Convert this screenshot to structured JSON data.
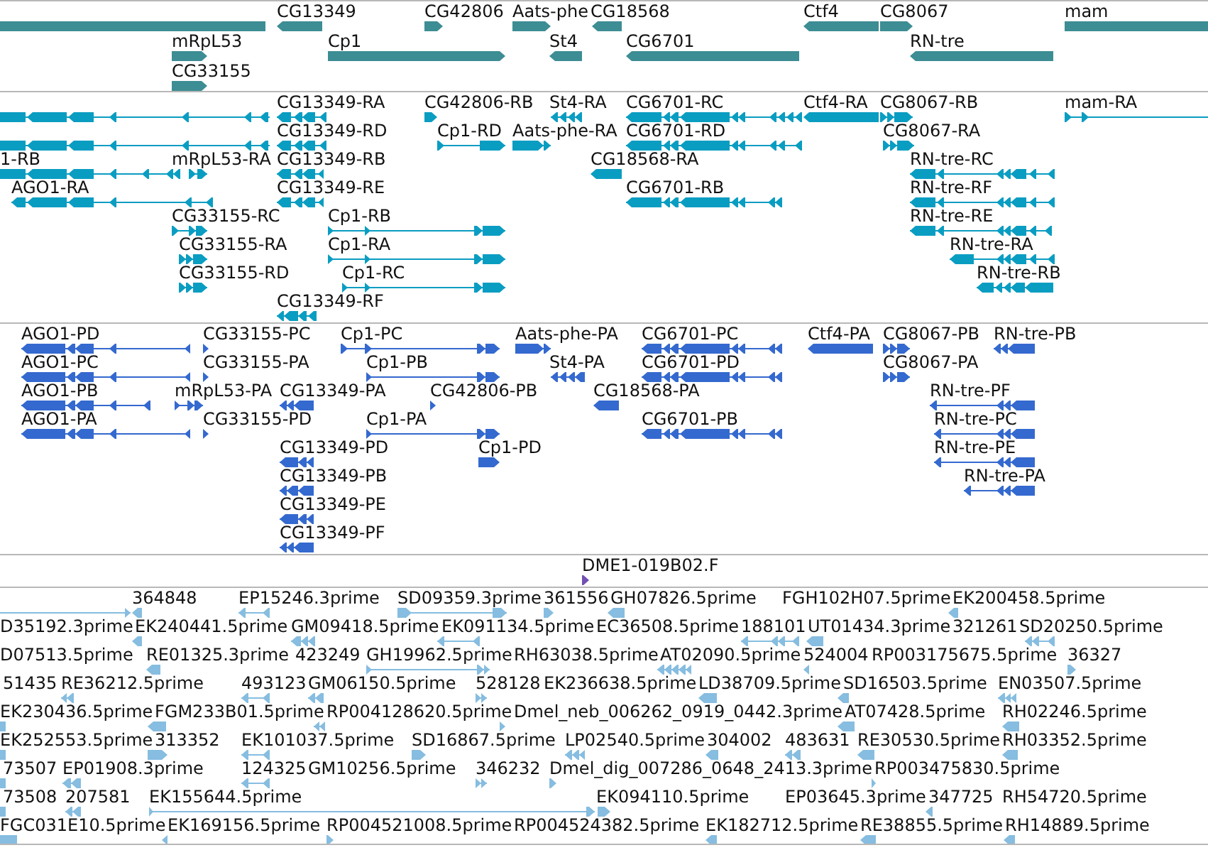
{
  "tracks": [
    {
      "kind": "gene",
      "features": [
        {
          "reverse": true
        },
        {
          "label": "CG13349",
          "reverse": true
        },
        {
          "label": "CG42806",
          "reverse": false
        },
        {
          "label": "Aats-phe",
          "reverse": false
        },
        {
          "label": "CG18568",
          "reverse": true
        },
        {
          "label": "Ctf4",
          "reverse": true
        },
        {
          "label": "CG8067",
          "reverse": false
        },
        {
          "label": "mam",
          "reverse": false
        },
        {
          "label": "mRpL53",
          "reverse": false
        },
        {
          "label": "Cp1",
          "reverse": false
        },
        {
          "label": "St4",
          "reverse": true
        },
        {
          "label": "CG6701",
          "reverse": true
        },
        {
          "label": "RN-tre",
          "reverse": true
        },
        {
          "label": "CG33155",
          "reverse": false
        }
      ]
    },
    {
      "kind": "transcript",
      "features": [
        {
          "reverse": true
        },
        {
          "label": "CG13349-RA",
          "reverse": true
        },
        {
          "label": "CG42806-RB",
          "reverse": false
        },
        {
          "label": "St4-RA",
          "reverse": true
        },
        {
          "label": "CG6701-RC",
          "reverse": true
        },
        {
          "label": "Ctf4-RA",
          "reverse": true
        },
        {
          "label": "CG8067-RB",
          "reverse": false
        },
        {
          "label": "mam-RA",
          "reverse": false
        },
        {
          "reverse": true
        },
        {
          "label": "CG13349-RD",
          "reverse": true
        },
        {
          "label": "Cp1-RD",
          "reverse": false
        },
        {
          "label": "Aats-phe-RA",
          "reverse": false
        },
        {
          "label": "CG6701-RD",
          "reverse": true
        },
        {
          "label": "CG8067-RA",
          "reverse": false
        },
        {
          "label": "1-RB",
          "reverse": true
        },
        {
          "label": "mRpL53-RA",
          "reverse": false
        },
        {
          "label": "CG13349-RB",
          "reverse": true
        },
        {
          "label": "CG18568-RA",
          "reverse": true
        },
        {
          "label": "RN-tre-RC",
          "reverse": true
        },
        {
          "label": "AGO1-RA",
          "reverse": true
        },
        {
          "label": "CG13349-RE",
          "reverse": true
        },
        {
          "label": "CG6701-RB",
          "reverse": true
        },
        {
          "label": "RN-tre-RF",
          "reverse": true
        },
        {
          "label": "CG33155-RC",
          "reverse": false
        },
        {
          "label": "Cp1-RB",
          "reverse": false
        },
        {
          "label": "RN-tre-RE",
          "reverse": true
        },
        {
          "label": "CG33155-RA",
          "reverse": false
        },
        {
          "label": "Cp1-RA",
          "reverse": false
        },
        {
          "label": "RN-tre-RA",
          "reverse": true
        },
        {
          "label": "CG33155-RD",
          "reverse": false
        },
        {
          "label": "Cp1-RC",
          "reverse": false
        },
        {
          "label": "RN-tre-RB",
          "reverse": true
        },
        {
          "label": "CG13349-RF",
          "reverse": true
        }
      ]
    },
    {
      "kind": "protein",
      "features": [
        {
          "label": "AGO1-PD",
          "reverse": true
        },
        {
          "label": "CG33155-PC",
          "reverse": false
        },
        {
          "label": "Cp1-PC",
          "reverse": false
        },
        {
          "label": "Aats-phe-PA",
          "reverse": false
        },
        {
          "label": "CG6701-PC",
          "reverse": true
        },
        {
          "label": "Ctf4-PA",
          "reverse": true
        },
        {
          "label": "CG8067-PB",
          "reverse": false
        },
        {
          "label": "RN-tre-PB",
          "reverse": true
        },
        {
          "label": "AGO1-PC",
          "reverse": true
        },
        {
          "label": "CG33155-PA",
          "reverse": false
        },
        {
          "label": "Cp1-PB",
          "reverse": false
        },
        {
          "label": "St4-PA",
          "reverse": true
        },
        {
          "label": "CG6701-PD",
          "reverse": true
        },
        {
          "label": "CG8067-PA",
          "reverse": false
        },
        {
          "label": "AGO1-PB",
          "reverse": true
        },
        {
          "label": "mRpL53-PA",
          "reverse": false
        },
        {
          "label": "CG13349-PA",
          "reverse": true
        },
        {
          "label": "CG42806-PB",
          "reverse": false
        },
        {
          "label": "CG18568-PA",
          "reverse": true
        },
        {
          "label": "RN-tre-PF",
          "reverse": true
        },
        {
          "label": "AGO1-PA",
          "reverse": true
        },
        {
          "label": "CG33155-PD",
          "reverse": false
        },
        {
          "label": "Cp1-PA",
          "reverse": false
        },
        {
          "label": "CG6701-PB",
          "reverse": true
        },
        {
          "label": "RN-tre-PC",
          "reverse": true
        },
        {
          "label": "CG13349-PD",
          "reverse": true
        },
        {
          "label": "Cp1-PD",
          "reverse": false
        },
        {
          "label": "RN-tre-PE",
          "reverse": true
        },
        {
          "label": "CG13349-PB",
          "reverse": true
        },
        {
          "label": "RN-tre-PA",
          "reverse": true
        },
        {
          "label": "CG13349-PE",
          "reverse": true
        },
        {
          "label": "CG13349-PF",
          "reverse": true
        }
      ]
    },
    {
      "kind": "clone",
      "features": [
        {
          "label": "DME1-019B02.F",
          "reverse": false
        }
      ]
    },
    {
      "kind": "est",
      "features": [
        {
          "reverse": false
        },
        {
          "label": "364848",
          "reverse": true
        },
        {
          "label": "EP15246.3prime",
          "reverse": true
        },
        {
          "label": "SD09359.3prime",
          "reverse": false
        },
        {
          "label": "361556",
          "reverse": false
        },
        {
          "label": "GH07826.5prime",
          "reverse": true
        },
        {
          "label": "FGH102H07.5prime"
        },
        {
          "label": "EK200458.5prime",
          "reverse": true
        },
        {
          "label": "D35192.3prime"
        },
        {
          "label": "EK240441.5prime",
          "reverse": true
        },
        {
          "label": "GM09418.5prime",
          "reverse": true
        },
        {
          "label": "EK091134.5prime",
          "reverse": true
        },
        {
          "label": "EC36508.5prime"
        },
        {
          "label": "188101",
          "reverse": true
        },
        {
          "label": "UT01434.3prime",
          "reverse": true
        },
        {
          "label": "321261"
        },
        {
          "label": "SD20250.5prime",
          "reverse": true
        },
        {
          "label": "D07513.5prime"
        },
        {
          "label": "RE01325.3prime",
          "reverse": true
        },
        {
          "label": "423249"
        },
        {
          "label": "GH19962.5prime",
          "reverse": false
        },
        {
          "label": "RH63038.5prime"
        },
        {
          "label": "AT02090.5prime",
          "reverse": true
        },
        {
          "label": "524004",
          "reverse": true
        },
        {
          "label": "RP003175675.5prime"
        },
        {
          "label": "36327",
          "reverse": false
        },
        {
          "label": "51435"
        },
        {
          "label": "RE36212.5prime",
          "reverse": true
        },
        {
          "label": "493123",
          "reverse": true
        },
        {
          "label": "GM06150.5prime",
          "reverse": true
        },
        {
          "label": "528128",
          "reverse": false
        },
        {
          "label": "EK236638.5prime"
        },
        {
          "label": "LD38709.5prime",
          "reverse": true
        },
        {
          "label": "SD16503.5prime",
          "reverse": true
        },
        {
          "label": "EN03507.5prime",
          "reverse": true
        },
        {
          "label": "EK230436.5prime",
          "reverse": true
        },
        {
          "label": "FGM233B01.5prime",
          "reverse": true
        },
        {
          "label": "RP004128620.5prime",
          "reverse": true
        },
        {
          "label": "Dmel_neb_006262_0919_0442.3prime",
          "reverse": false
        },
        {
          "label": "AT07428.5prime",
          "reverse": true
        },
        {
          "label": "RH02246.5prime",
          "reverse": true
        },
        {
          "label": "EK252553.5prime",
          "reverse": true
        },
        {
          "label": "313352",
          "reverse": false
        },
        {
          "label": "EK101037.5prime",
          "reverse": true
        },
        {
          "label": "SD16867.5prime",
          "reverse": false
        },
        {
          "label": "LP02540.5prime",
          "reverse": true
        },
        {
          "label": "304002",
          "reverse": true
        },
        {
          "label": "483631",
          "reverse": true
        },
        {
          "label": "RE30530.5prime",
          "reverse": true
        },
        {
          "label": "RH03352.5prime",
          "reverse": true
        },
        {
          "label": "73507",
          "reverse": true
        },
        {
          "label": "EP01908.3prime",
          "reverse": true
        },
        {
          "label": "124325",
          "reverse": true
        },
        {
          "label": "GM10256.5prime"
        },
        {
          "label": "346232",
          "reverse": false
        },
        {
          "label": "Dmel_dig_007286_0648_2413.3prime",
          "reverse": false
        },
        {
          "label": "RP003475830.5prime",
          "reverse": false
        },
        {
          "label": "73508",
          "reverse": true
        },
        {
          "label": "207581",
          "reverse": true
        },
        {
          "label": "EK155644.5prime",
          "reverse": false
        },
        {
          "label": "EK094110.5prime",
          "reverse": false
        },
        {
          "label": "EP03645.3prime"
        },
        {
          "label": "347725",
          "reverse": true
        },
        {
          "label": "RH54720.5prime"
        },
        {
          "label": "FGC031E10.5prime",
          "reverse": true
        },
        {
          "label": "EK169156.5prime",
          "reverse": true
        },
        {
          "label": "RP004521008.5prime",
          "reverse": false
        },
        {
          "label": "RP004524382.5prime"
        },
        {
          "label": "EK182712.5prime",
          "reverse": true
        },
        {
          "label": "RE38855.5prime",
          "reverse": true
        },
        {
          "label": "RH14889.5prime",
          "reverse": true
        }
      ]
    }
  ]
}
